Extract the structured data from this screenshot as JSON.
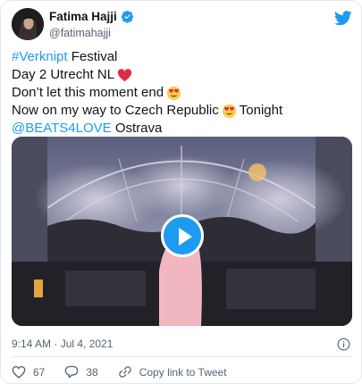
{
  "author": {
    "name": "Fatima Hajji",
    "handle": "@fatimahajji",
    "verified": true
  },
  "tweet": {
    "line1_hashtag": "#Verknipt",
    "line1_rest": " Festival",
    "line2_text": "Day 2 Utrecht NL",
    "line2_emoji": "red-heart",
    "line3_text": "Don’t let this moment end",
    "line3_emoji": "smiling-face-with-heart-eyes",
    "line4_text_before": "Now on my way to Czech Republic",
    "line4_emoji": "smiling-face-with-heart-eyes",
    "line4_text_after": "Tonight",
    "line5_mention": "@BEATS4LOVE",
    "line5_rest": " Ostrava"
  },
  "media": {
    "type": "video",
    "description_icon": "play-icon"
  },
  "meta": {
    "timestamp": "9:14 AM · Jul 4, 2021"
  },
  "actions": {
    "likes": "67",
    "replies": "38",
    "copy_link_label": "Copy link to Tweet"
  },
  "colors": {
    "accent": "#1d9bf0",
    "text": "#0f1419",
    "muted": "#536471",
    "border": "#e1e8ed"
  }
}
